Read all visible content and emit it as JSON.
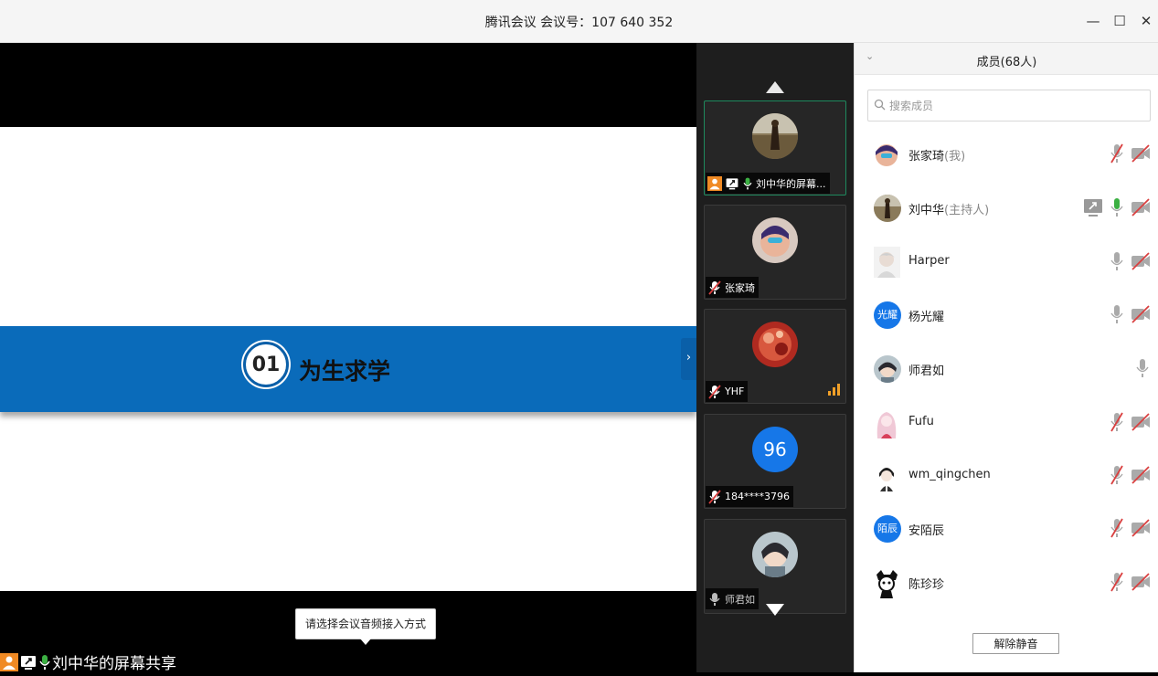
{
  "window": {
    "title": "腾讯会议 会议号：107 640 352",
    "minimize_glyph": "—",
    "maximize_glyph": "☐",
    "close_glyph": "✕"
  },
  "slide": {
    "number": "01",
    "heading": "为生求学"
  },
  "tooltip": "请选择会议音频接入方式",
  "share_bar": {
    "label": "刘中华的屏幕共享",
    "icons": [
      "person-icon",
      "screen-share-icon",
      "mic-active-icon"
    ]
  },
  "video_strip": {
    "tiles": [
      {
        "label": "刘中华的屏幕...",
        "active": true,
        "mic": "active",
        "icons": [
          "person-icon",
          "screen-share-icon",
          "mic-active-icon"
        ]
      },
      {
        "label": "张家琦",
        "mic": "muted"
      },
      {
        "label": "YHF",
        "mic": "muted",
        "signal": true
      },
      {
        "label": "184****3796",
        "mic": "muted",
        "avatar_text": "96"
      },
      {
        "label": "师君如",
        "mic": "idle"
      }
    ]
  },
  "members_panel": {
    "title": "成员(68人)",
    "search_placeholder": "搜索成员",
    "members": [
      {
        "name": "张家琦",
        "tag": "(我)",
        "mic": "muted",
        "video": "off"
      },
      {
        "name": "刘中华",
        "tag": "(主持人)",
        "mic": "active",
        "video": "off",
        "sharing": true
      },
      {
        "name": "Harper",
        "tag": "",
        "mic": "idle",
        "video": "off"
      },
      {
        "name": "杨光耀",
        "tag": "",
        "mic": "idle",
        "video": "off",
        "avatar_text": "光耀"
      },
      {
        "name": "师君如",
        "tag": "",
        "mic": "idle",
        "video": "none"
      },
      {
        "name": "Fufu",
        "tag": "",
        "mic": "muted",
        "video": "off"
      },
      {
        "name": "wm_qingchen",
        "tag": "",
        "mic": "muted",
        "video": "off"
      },
      {
        "name": "安陌辰",
        "tag": "",
        "mic": "muted",
        "video": "off",
        "avatar_text": "陌辰"
      },
      {
        "name": "陈珍珍",
        "tag": "",
        "mic": "muted",
        "video": "off"
      }
    ],
    "unmute_all_button": "解除静音"
  },
  "colors": {
    "banner_blue": "#0a6bba",
    "accent_blue": "#1677e8",
    "mic_active_green": "#3cb043",
    "muted_red": "#d94040",
    "signal_orange": "#f0a028"
  }
}
